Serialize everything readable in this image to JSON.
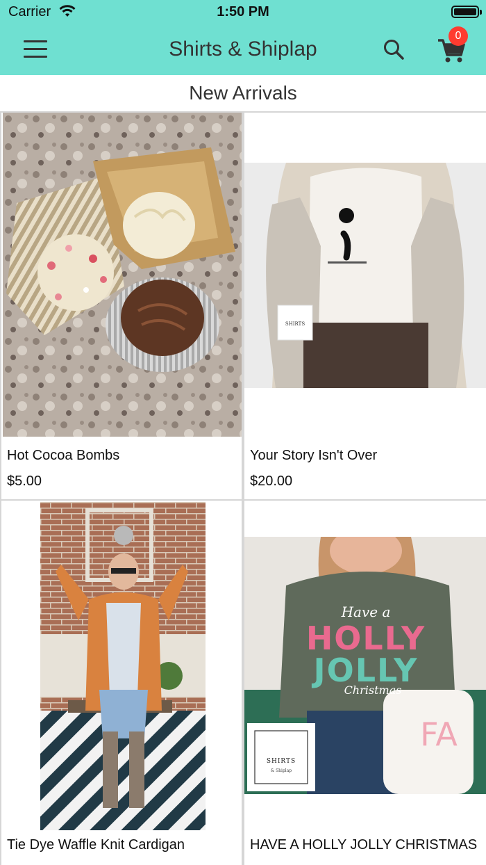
{
  "status_bar": {
    "carrier": "Carrier",
    "time": "1:50 PM"
  },
  "navbar": {
    "title": "Shirts & Shiplap",
    "cart_count": "0",
    "accent": "#6fe0d1",
    "badge_color": "#ff3b30"
  },
  "section_title": "New Arrivals",
  "products": [
    {
      "name": "Hot Cocoa Bombs",
      "price": "$5.00"
    },
    {
      "name": "Your Story Isn't Over",
      "price": "$20.00"
    },
    {
      "name": "Tie Dye Waffle Knit Cardigan",
      "price": ""
    },
    {
      "name": "HAVE A HOLLY JOLLY CHRISTMAS",
      "price": ""
    }
  ],
  "brand_logo": {
    "line1": "SHIRTS",
    "line2": "& Shiplap"
  },
  "shirt_text": {
    "line1": "Have a",
    "line2": "HOLLY",
    "line3": "JOLLY",
    "line4": "Christmas"
  }
}
